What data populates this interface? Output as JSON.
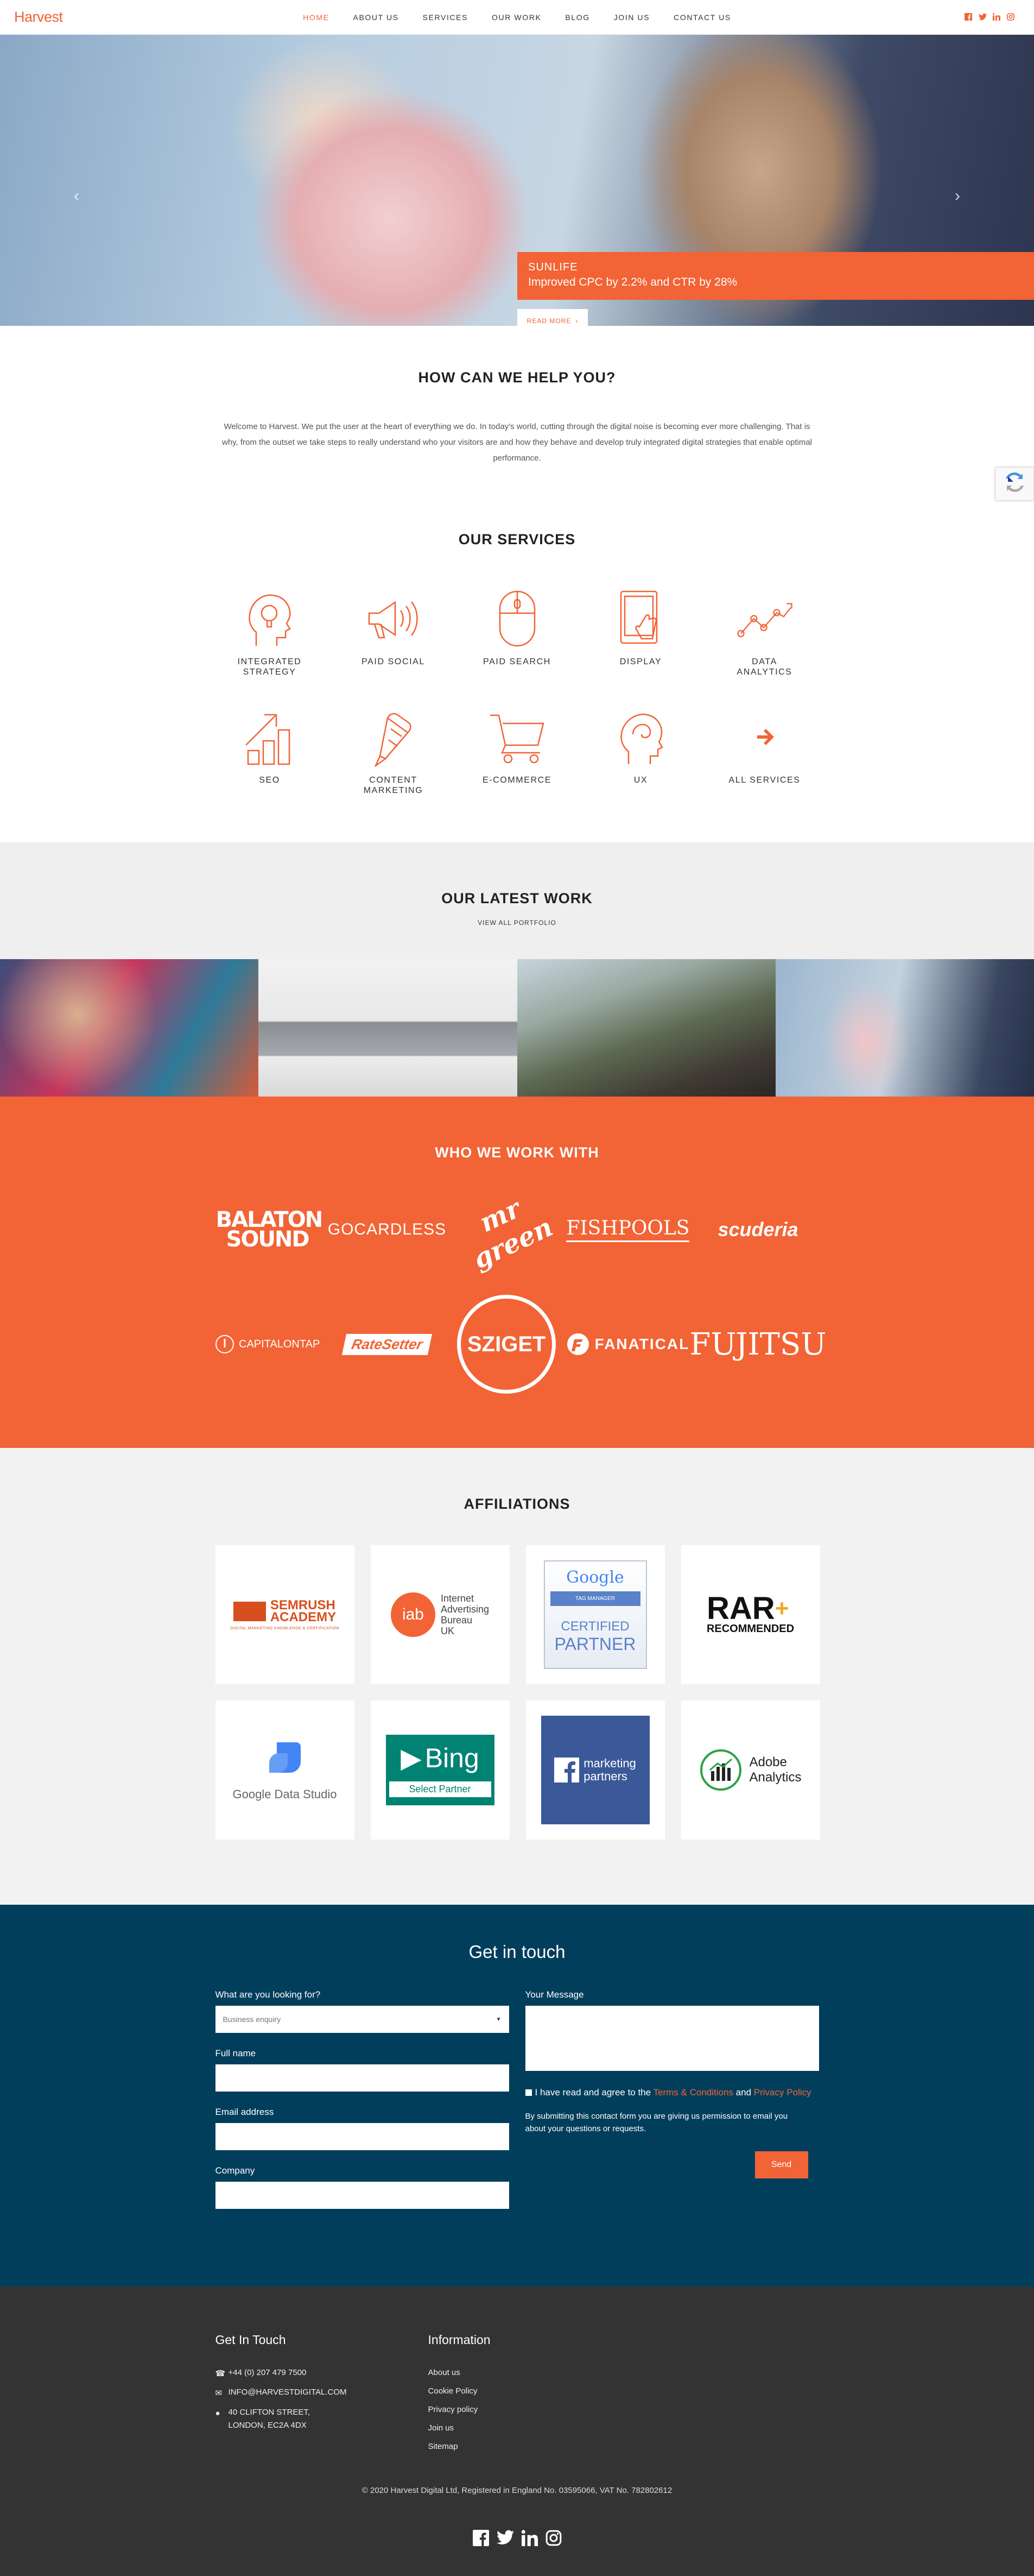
{
  "brand": {
    "logo": "Harvest",
    "accent": "#f26335",
    "navy": "#013e5c",
    "footer_bg": "#333333"
  },
  "nav": {
    "items": [
      "HOME",
      "ABOUT US",
      "SERVICES",
      "OUR WORK",
      "BLOG",
      "JOIN US",
      "CONTACT US"
    ],
    "active": "HOME",
    "social_icons": [
      "facebook-icon",
      "twitter-icon",
      "linkedin-icon",
      "instagram-icon"
    ]
  },
  "hero": {
    "client": "SUNLIFE",
    "headline": "Improved CPC by 2.2% and CTR by 28%",
    "read_more": "READ MORE"
  },
  "help": {
    "title": "HOW CAN WE HELP YOU?",
    "body": "Welcome to Harvest. We put the user at the heart of everything we do. In today's world, cutting through the digital noise is becoming ever more challenging. That is why, from the outset we take steps to really understand who your visitors are and how they behave and develop truly integrated digital strategies that enable optimal performance."
  },
  "services": {
    "title": "OUR SERVICES",
    "items": [
      {
        "label": "INTEGRATED STRATEGY",
        "icon": "head-lightbulb-icon"
      },
      {
        "label": "PAID SOCIAL",
        "icon": "megaphone-icon"
      },
      {
        "label": "PAID SEARCH",
        "icon": "mouse-icon"
      },
      {
        "label": "DISPLAY",
        "icon": "tablet-touch-icon"
      },
      {
        "label": "DATA ANALYTICS",
        "icon": "line-graph-icon"
      },
      {
        "label": "SEO",
        "icon": "bar-growth-icon"
      },
      {
        "label": "CONTENT MARKETING",
        "icon": "pencil-icon"
      },
      {
        "label": "E-COMMERCE",
        "icon": "cart-icon"
      },
      {
        "label": "UX",
        "icon": "head-icon"
      },
      {
        "label": "ALL SERVICES",
        "icon": "arrow-right-icon"
      }
    ]
  },
  "latest": {
    "title": "OUR LATEST WORK",
    "view_all": "VIEW ALL PORTFOLIO"
  },
  "clients": {
    "title": "WHO WE WORK WITH",
    "logos": [
      "BALATON SOUND",
      "GOCARDLESS",
      "mr green",
      "FISHPOOLS",
      "scuderia",
      "CAPITALONTAP",
      "RateSetter",
      "SZIGET",
      "FANATICAL",
      "FUJITSU"
    ]
  },
  "affiliations": {
    "title": "AFFILIATIONS",
    "semrush": {
      "name": "SEMRUSH",
      "sub": "ACADEMY",
      "tag": "DIGITAL MARKETING KNOWLEDGE & CERTIFICATION"
    },
    "iab": {
      "mark": "iab",
      "lines": [
        "Internet",
        "Advertising",
        "Bureau",
        "UK"
      ]
    },
    "google": {
      "name": "Google",
      "tag": "TAG MANAGER",
      "cert": "CERTIFIED",
      "partner": "PARTNER"
    },
    "rar": {
      "name": "RAR",
      "sub": "RECOMMENDED"
    },
    "gds": {
      "name": "Google Data Studio"
    },
    "bing": {
      "name": "Bing",
      "sub": "Select Partner"
    },
    "fb": {
      "line1": "marketing",
      "line2": "partners"
    },
    "adobe": {
      "line1": "Adobe",
      "line2": "Analytics"
    }
  },
  "contact": {
    "title": "Get in touch",
    "looking_label": "What are you looking for?",
    "looking_value": "Business enquiry",
    "name_label": "Full name",
    "email_label": "Email address",
    "company_label": "Company",
    "message_label": "Your Message",
    "consent_pre": "I have read and agree to the",
    "consent_terms": "Terms & Conditions",
    "consent_and": "and",
    "consent_privacy": "Privacy Policy",
    "notice": "By submitting this contact form you are giving us permission to email you about your questions or requests.",
    "send": "Send"
  },
  "footer": {
    "getintouch_title": "Get In Touch",
    "phone": "+44 (0) 207 479 7500",
    "email": "INFO@HARVESTDIGITAL.COM",
    "address1": "40 CLIFTON STREET,",
    "address2": "LONDON, EC2A 4DX",
    "info_title": "Information",
    "links": [
      "About us",
      "Cookie Policy",
      "Privacy policy",
      "Join us",
      "Sitemap"
    ],
    "copyright": "© 2020 Harvest Digital Ltd, Registered in England No. 03595066, VAT No. 782802612"
  }
}
